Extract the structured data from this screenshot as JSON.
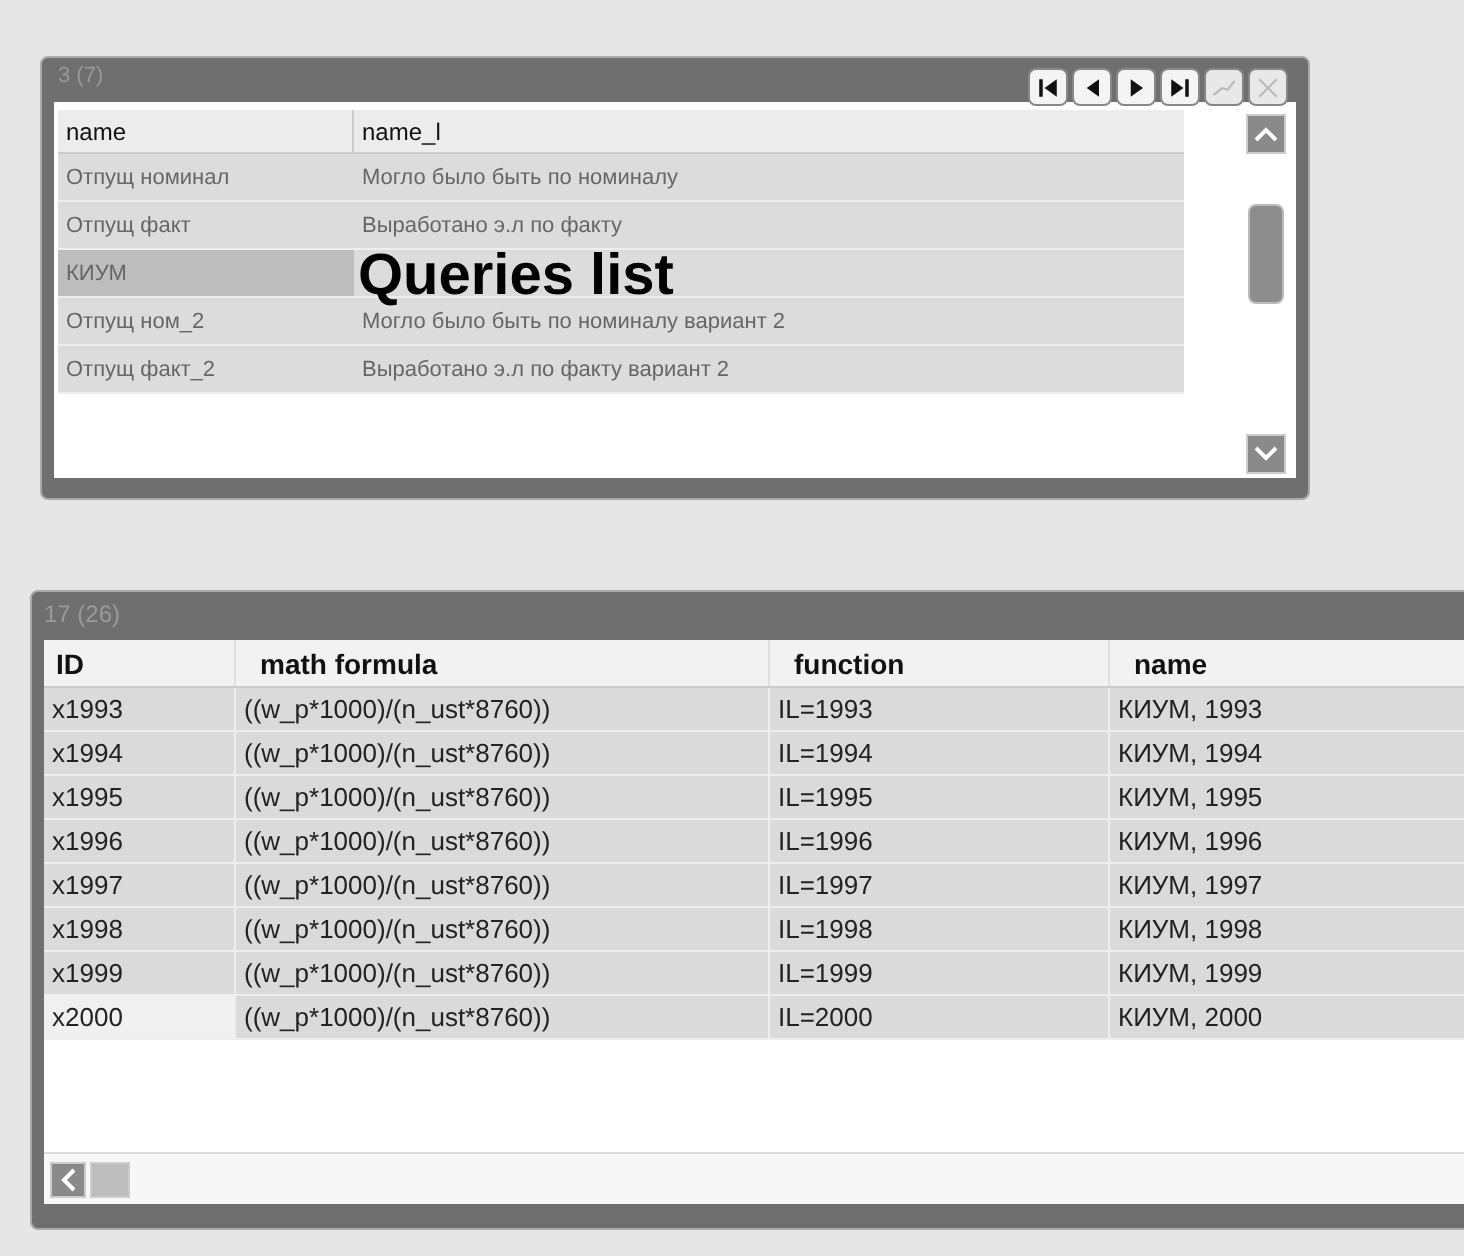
{
  "queries_panel": {
    "title": "3 (7)",
    "overlay_title": "Queries list",
    "columns": [
      "name",
      "name_l"
    ],
    "rows": [
      {
        "cells": [
          "Отпущ номинал",
          "Могло было быть по номиналу"
        ],
        "selected": false
      },
      {
        "cells": [
          "Отпущ факт",
          "Выработано э.л по факту"
        ],
        "selected": false
      },
      {
        "cells": [
          "КИУМ",
          ""
        ],
        "selected": true
      },
      {
        "cells": [
          "Отпущ ном_2",
          "Могло было быть по номиналу вариант 2"
        ],
        "selected": false
      },
      {
        "cells": [
          "Отпущ факт_2",
          "Выработано э.л по факту вариант 2"
        ],
        "selected": false
      }
    ]
  },
  "formula_panel": {
    "title": "17 (26)",
    "columns": [
      "ID",
      "math formula",
      "function",
      "name"
    ],
    "rows": [
      {
        "cells": [
          "x1993",
          "((w_p*1000)/(n_ust*8760))",
          "IL=1993",
          "КИУМ, 1993"
        ],
        "selected": false
      },
      {
        "cells": [
          "x1994",
          "((w_p*1000)/(n_ust*8760))",
          "IL=1994",
          "КИУМ, 1994"
        ],
        "selected": false
      },
      {
        "cells": [
          "x1995",
          "((w_p*1000)/(n_ust*8760))",
          "IL=1995",
          "КИУМ, 1995"
        ],
        "selected": false
      },
      {
        "cells": [
          "x1996",
          "((w_p*1000)/(n_ust*8760))",
          "IL=1996",
          "КИУМ, 1996"
        ],
        "selected": false
      },
      {
        "cells": [
          "x1997",
          "((w_p*1000)/(n_ust*8760))",
          "IL=1997",
          "КИУМ, 1997"
        ],
        "selected": false
      },
      {
        "cells": [
          "x1998",
          "((w_p*1000)/(n_ust*8760))",
          "IL=1998",
          "КИУМ, 1998"
        ],
        "selected": false
      },
      {
        "cells": [
          "x1999",
          "((w_p*1000)/(n_ust*8760))",
          "IL=1999",
          "КИУМ, 1999"
        ],
        "selected": false
      },
      {
        "cells": [
          "x2000",
          "((w_p*1000)/(n_ust*8760))",
          "IL=2000",
          "КИУМ, 2000"
        ],
        "selected": true
      }
    ]
  }
}
